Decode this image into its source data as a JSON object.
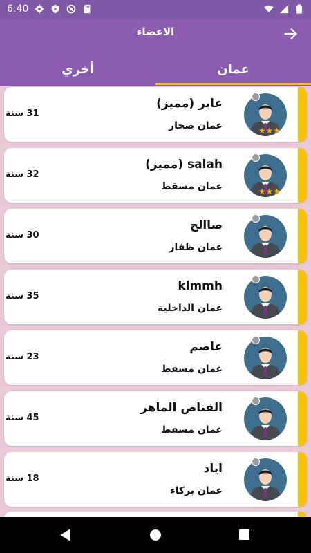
{
  "status_bar": {
    "time": "6:40",
    "left_icons": [
      "gear-icon",
      "shield-play-icon",
      "at-sign-icon",
      "sd-card-icon"
    ],
    "right_icons": [
      "wifi-icon",
      "signal-icon",
      "battery-icon"
    ]
  },
  "header": {
    "title": "الاعضاء",
    "back_icon": "arrow-right-icon"
  },
  "tabs": [
    {
      "label": "أخري",
      "active": false
    },
    {
      "label": "عمان",
      "active": true
    }
  ],
  "members": [
    {
      "name": "عابر (مميز)",
      "city": "عمان صحار",
      "age": "31 سنة",
      "stars": "★★★",
      "premium": true
    },
    {
      "name": "salah (مميز)",
      "city": "عمان مسقط",
      "age": "32 سنة",
      "stars": "★★★",
      "premium": true
    },
    {
      "name": "صاالح",
      "city": "عمان ظفار",
      "age": "30 سنة",
      "stars": "",
      "premium": false
    },
    {
      "name": "klmmh",
      "city": "عمان الداخلية",
      "age": "35 سنة",
      "stars": "",
      "premium": false
    },
    {
      "name": "عاصم",
      "city": "عمان مسقط",
      "age": "23 سنة",
      "stars": "",
      "premium": false
    },
    {
      "name": "القناص الماهر",
      "city": "عمان مسقط",
      "age": "45 سنة",
      "stars": "",
      "premium": false
    },
    {
      "name": "اياد",
      "city": "عمان بركاء",
      "age": "18 سنة",
      "stars": "",
      "premium": false
    }
  ],
  "colors": {
    "status_bar": "#7f59a7",
    "app_bar": "#8c5cb0",
    "accent": "#f7c000",
    "list_background": "#e9c8d8",
    "avatar_circle": "#3f6f8f"
  },
  "nav_bar_icons": [
    "back-triangle-icon",
    "home-circle-icon",
    "recents-square-icon"
  ]
}
